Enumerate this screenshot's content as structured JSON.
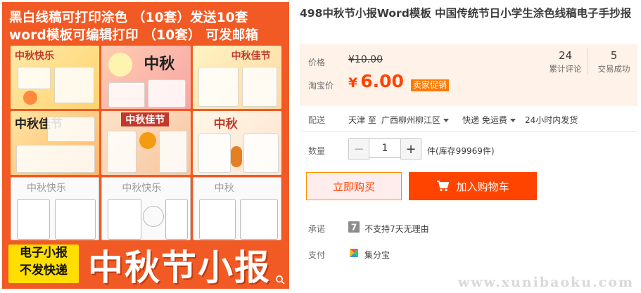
{
  "image": {
    "banner_line1": "黑白线稿可打印涂色  （10套）发送10套",
    "banner_line2": "word模板可编辑打印 （10套） 可发邮箱",
    "thumbs": [
      {
        "title": "中秋快乐"
      },
      {
        "title": "中秋"
      },
      {
        "title": "中秋佳节"
      },
      {
        "title": "中秋佳节"
      },
      {
        "title": "中秋佳节"
      },
      {
        "title": "中秋"
      },
      {
        "title": "中秋快乐"
      },
      {
        "title": "中秋快乐"
      },
      {
        "title": "中秋"
      }
    ],
    "footer_box_line1": "电子小报",
    "footer_box_line2": "不发快递",
    "footer_title": "中秋节小报",
    "background_color": "#f15a24",
    "zoom_icon": "magnifier-icon"
  },
  "product": {
    "title": "498中秋节小报Word模板 中国传统节日小学生涂色线稿电子手抄报"
  },
  "price": {
    "label_price": "价格",
    "original": "¥10.00",
    "label_taobao": "淘宝价",
    "currency": "¥",
    "current": "6.00",
    "promo": "卖家促销",
    "reviews_count": "24",
    "reviews_label": "累计评论",
    "sales_count": "5",
    "sales_label": "交易成功",
    "accent_color": "#ff4400"
  },
  "shipping": {
    "label": "配送",
    "from": "天津 至",
    "to": "广西柳州柳江区",
    "method": "快递 免运费",
    "time": "24小时内发货"
  },
  "quantity": {
    "label": "数量",
    "minus": "−",
    "value": "1",
    "plus": "+",
    "stock": "件(库存99969件)"
  },
  "actions": {
    "buy_now": "立即购买",
    "add_to_cart": "加入购物车",
    "cart_icon": "cart-icon"
  },
  "promise": {
    "label": "承诺",
    "icon": "seven-day-icon",
    "text": "不支持7天无理由"
  },
  "payment": {
    "label": "支付",
    "icon": "jifenbao-icon",
    "text": "集分宝"
  },
  "watermark": "www.xunibaoku.com"
}
